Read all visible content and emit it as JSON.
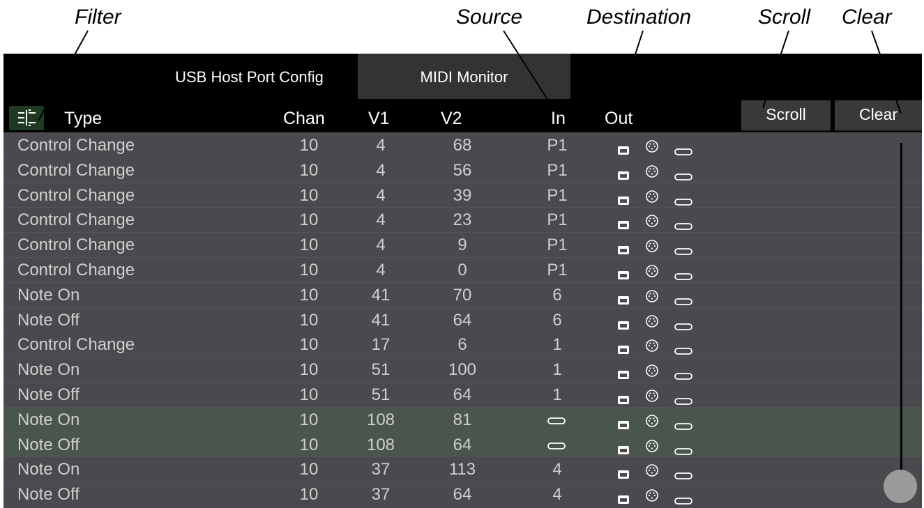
{
  "annotations": {
    "filter": "Filter",
    "source": "Source",
    "destination": "Destination",
    "scroll": "Scroll",
    "clear": "Clear"
  },
  "tabs": {
    "usb_host_port_config": "USB Host Port Config",
    "midi_monitor": "MIDI Monitor",
    "active": "MIDI Monitor"
  },
  "header": {
    "type": "Type",
    "chan": "Chan",
    "v1": "V1",
    "v2": "V2",
    "in": "In",
    "out": "Out",
    "filter_icon": "filter-sliders-icon",
    "scroll_label": "Scroll",
    "clear_label": "Clear"
  },
  "out_icons": [
    "device-port-icon",
    "midi-din-icon",
    "usb-icon"
  ],
  "usb_source_icon": "usb-icon",
  "rows": [
    {
      "type": "Control Change",
      "chan": "10",
      "v1": "4",
      "v2": "68",
      "in": "P1"
    },
    {
      "type": "Control Change",
      "chan": "10",
      "v1": "4",
      "v2": "56",
      "in": "P1"
    },
    {
      "type": "Control Change",
      "chan": "10",
      "v1": "4",
      "v2": "39",
      "in": "P1"
    },
    {
      "type": "Control Change",
      "chan": "10",
      "v1": "4",
      "v2": "23",
      "in": "P1"
    },
    {
      "type": "Control Change",
      "chan": "10",
      "v1": "4",
      "v2": "9",
      "in": "P1"
    },
    {
      "type": "Control Change",
      "chan": "10",
      "v1": "4",
      "v2": "0",
      "in": "P1"
    },
    {
      "type": "Note On",
      "chan": "10",
      "v1": "41",
      "v2": "70",
      "in": "6"
    },
    {
      "type": "Note Off",
      "chan": "10",
      "v1": "41",
      "v2": "64",
      "in": "6"
    },
    {
      "type": "Control Change",
      "chan": "10",
      "v1": "17",
      "v2": "6",
      "in": "1"
    },
    {
      "type": "Note On",
      "chan": "10",
      "v1": "51",
      "v2": "100",
      "in": "1"
    },
    {
      "type": "Note Off",
      "chan": "10",
      "v1": "51",
      "v2": "64",
      "in": "1"
    },
    {
      "type": "Note On",
      "chan": "10",
      "v1": "108",
      "v2": "81",
      "in": "",
      "in_usb": true,
      "highlight": true
    },
    {
      "type": "Note Off",
      "chan": "10",
      "v1": "108",
      "v2": "64",
      "in": "",
      "in_usb": true,
      "highlight": true
    },
    {
      "type": "Note On",
      "chan": "10",
      "v1": "37",
      "v2": "113",
      "in": "4"
    },
    {
      "type": "Note Off",
      "chan": "10",
      "v1": "37",
      "v2": "64",
      "in": "4"
    }
  ],
  "colors": {
    "screen_bg": "#000000",
    "row_bg": "#4a4a4e",
    "row_highlight": "#4a564b",
    "filter_button": "#1f3a22",
    "text": "#cfcfcf"
  },
  "scrollbar_position": 1.0
}
